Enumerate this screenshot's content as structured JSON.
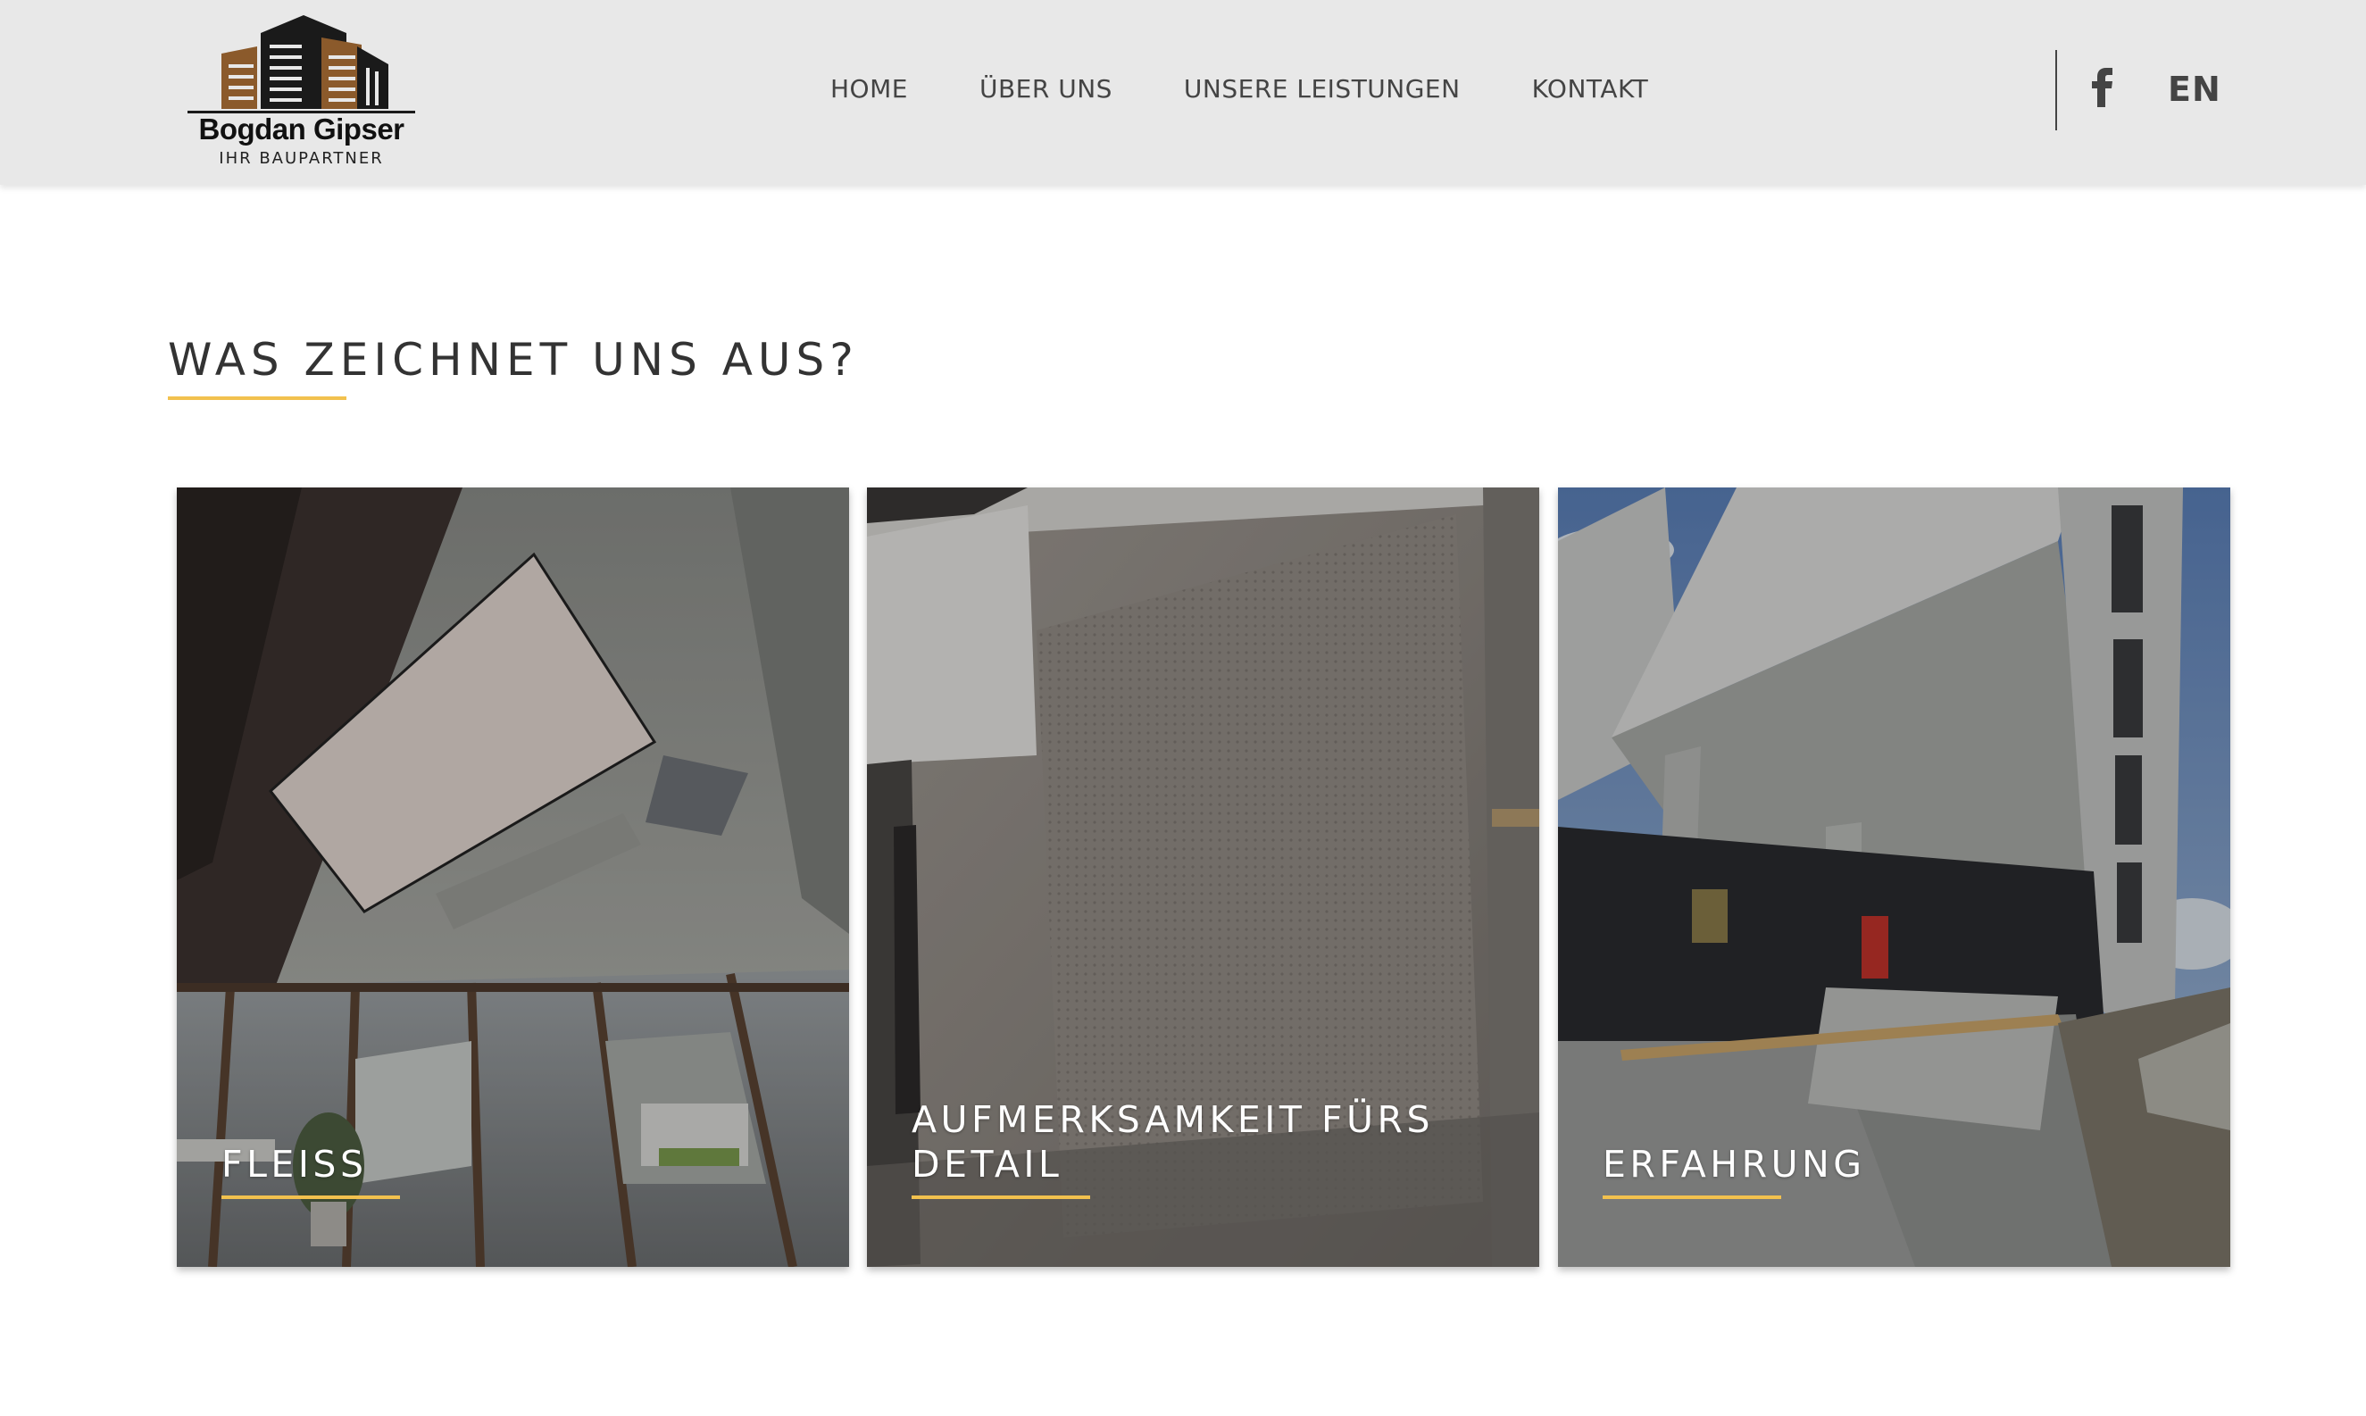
{
  "header": {
    "logo": {
      "name": "Bogdan Gipser",
      "tagline": "IHR BAUPARTNER"
    },
    "nav": [
      {
        "label": "HOME"
      },
      {
        "label": "ÜBER UNS"
      },
      {
        "label": "UNSERE LEISTUNGEN"
      },
      {
        "label": "KONTAKT"
      }
    ],
    "social_icon": "facebook-icon",
    "language": "EN"
  },
  "section": {
    "title": "WAS ZEICHNET UNS AUS?"
  },
  "cards": [
    {
      "label": "FLEISS",
      "image": "interior-ceiling-light-photo"
    },
    {
      "label": "AUFMERKSAMKEIT FÜRS\nDETAIL",
      "image": "perforated-wall-photo"
    },
    {
      "label": "ERFAHRUNG",
      "image": "building-exterior-photo"
    }
  ],
  "colors": {
    "header_bg": "#e8e8e8",
    "accent": "#f2c14e",
    "text": "#333333",
    "logo_brown": "#8b5a2b"
  }
}
